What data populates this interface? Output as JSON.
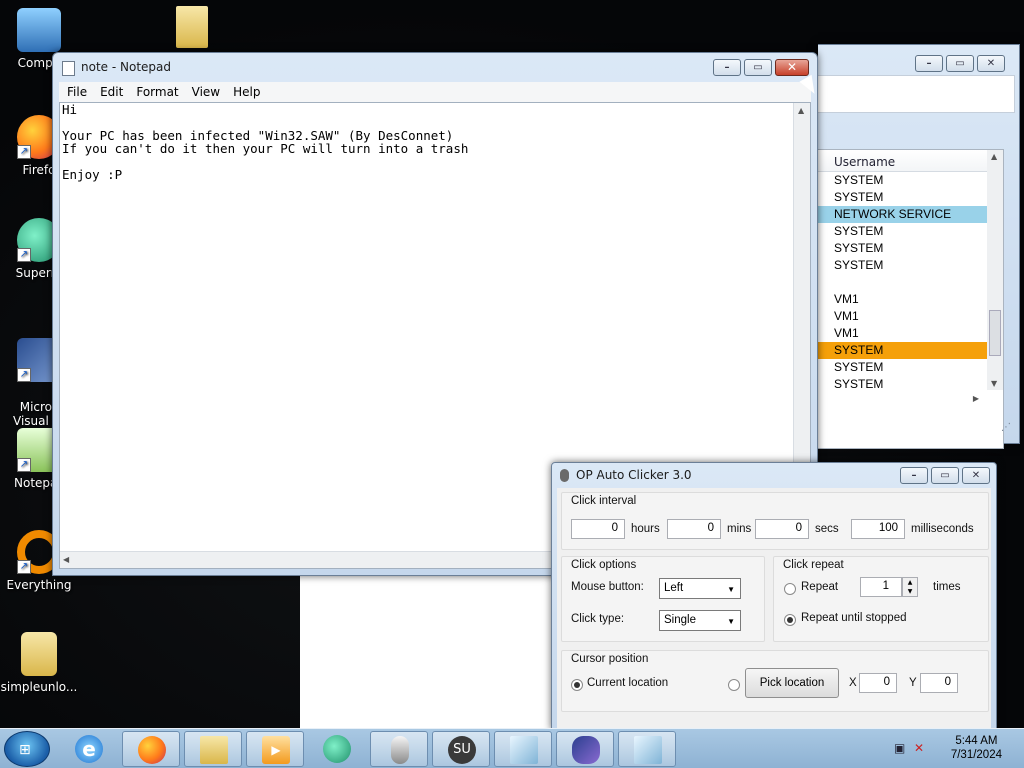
{
  "desktop": {
    "icons": [
      {
        "label": "Compu",
        "icon": "computer-icon"
      },
      {
        "label": "Firefo",
        "icon": "firefox-icon"
      },
      {
        "label": "Superm",
        "icon": "supermium-icon"
      },
      {
        "label": "Micros\nVisual St",
        "icon": "visual-studio-icon"
      },
      {
        "label": "Notepac",
        "icon": "notepad-plus-icon"
      },
      {
        "label": "Everything",
        "icon": "everything-icon"
      },
      {
        "label": "simpleunlo...",
        "icon": "folder-icon"
      }
    ]
  },
  "notepad": {
    "title": "note - Notepad",
    "menu": [
      "File",
      "Edit",
      "Format",
      "View",
      "Help"
    ],
    "content": "Hi\n\nYour PC has been infected \"Win32.SAW\" (By DesConnet)\nIf you can't do it then your PC will turn into a trash\n\nEnjoy :P"
  },
  "taskmgr": {
    "column_header": "Username",
    "rows": [
      {
        "user": "SYSTEM",
        "state": "normal"
      },
      {
        "user": "SYSTEM",
        "state": "normal"
      },
      {
        "user": "NETWORK SERVICE",
        "state": "highlight-blue"
      },
      {
        "user": "SYSTEM",
        "state": "normal"
      },
      {
        "user": "SYSTEM",
        "state": "normal"
      },
      {
        "user": "SYSTEM",
        "state": "normal"
      },
      {
        "user": "",
        "state": "normal"
      },
      {
        "user": "VM1",
        "state": "normal"
      },
      {
        "user": "VM1",
        "state": "normal"
      },
      {
        "user": "VM1",
        "state": "normal"
      },
      {
        "user": "SYSTEM",
        "state": "highlight-orange"
      },
      {
        "user": "SYSTEM",
        "state": "normal"
      },
      {
        "user": "SYSTEM",
        "state": "normal"
      }
    ]
  },
  "clicker": {
    "title": "OP Auto Clicker 3.0",
    "interval": {
      "legend": "Click interval",
      "hours": "0",
      "hours_label": "hours",
      "mins": "0",
      "mins_label": "mins",
      "secs": "0",
      "secs_label": "secs",
      "ms": "100",
      "ms_label": "milliseconds"
    },
    "options": {
      "legend": "Click options",
      "mouse_button_label": "Mouse button:",
      "mouse_button": "Left",
      "click_type_label": "Click type:",
      "click_type": "Single"
    },
    "repeat": {
      "legend": "Click repeat",
      "repeat_label": "Repeat",
      "repeat_count": "1",
      "times_label": "times",
      "until_stopped_label": "Repeat until stopped",
      "selected": "until_stopped"
    },
    "cursor": {
      "legend": "Cursor position",
      "current_label": "Current location",
      "pick_label": "Pick location",
      "x_label": "X",
      "x": "0",
      "y_label": "Y",
      "y": "0",
      "selected": "current"
    }
  },
  "taskbar": {
    "clock_time": "5:44 AM",
    "clock_date": "7/31/2024",
    "su_label": "SU",
    "buttons": [
      {
        "name": "internet-explorer",
        "active": false
      },
      {
        "name": "firefox",
        "active": true
      },
      {
        "name": "file-explorer",
        "active": true
      },
      {
        "name": "media-player",
        "active": true
      },
      {
        "name": "supermium",
        "active": false
      },
      {
        "name": "mouse-app",
        "active": true
      },
      {
        "name": "sumatra",
        "active": true
      },
      {
        "name": "notepad",
        "active": true
      },
      {
        "name": "visual-studio",
        "active": true
      },
      {
        "name": "notepad-2",
        "active": true
      }
    ]
  }
}
